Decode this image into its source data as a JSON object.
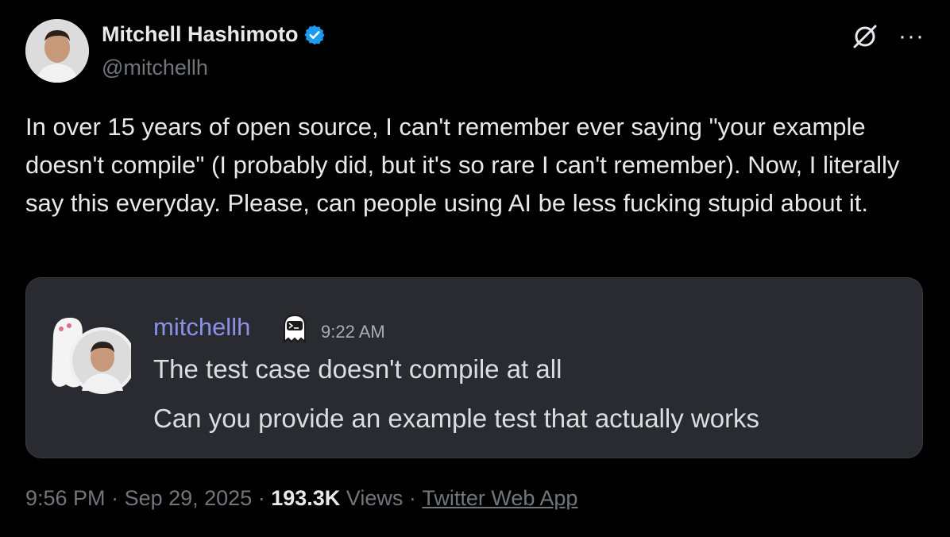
{
  "author": {
    "name": "Mitchell Hashimoto",
    "handle": "@mitchellh",
    "verified_icon": "verified-badge-icon",
    "avatar": "author-avatar"
  },
  "toolbar": {
    "grok_icon": "grok-icon",
    "more_label": "···"
  },
  "tweet": {
    "text": "In over 15 years of open source, I can't remember ever saying \"your example doesn't compile\" (I probably did, but it's so rare I can't remember). Now, I literally say this everyday. Please, can people using AI be less fucking stupid about it."
  },
  "embedded_message": {
    "username": "mitchellh",
    "time": "9:22 AM",
    "line1": "The test case doesn't compile at all",
    "line2": "Can you provide an example test that actually works",
    "badge_icon": "ghost-icon"
  },
  "meta": {
    "time": "9:56 PM",
    "separator1": " · ",
    "date": "Sep 29, 2025",
    "separator2": " · ",
    "views_count": "193.3K",
    "views_label": " Views",
    "separator3": " · ",
    "source": "Twitter Web App"
  },
  "colors": {
    "background": "#000000",
    "card": "#2a2b30",
    "username": "#8c90e8",
    "verified": "#1d9bf0",
    "muted": "#71767b"
  }
}
